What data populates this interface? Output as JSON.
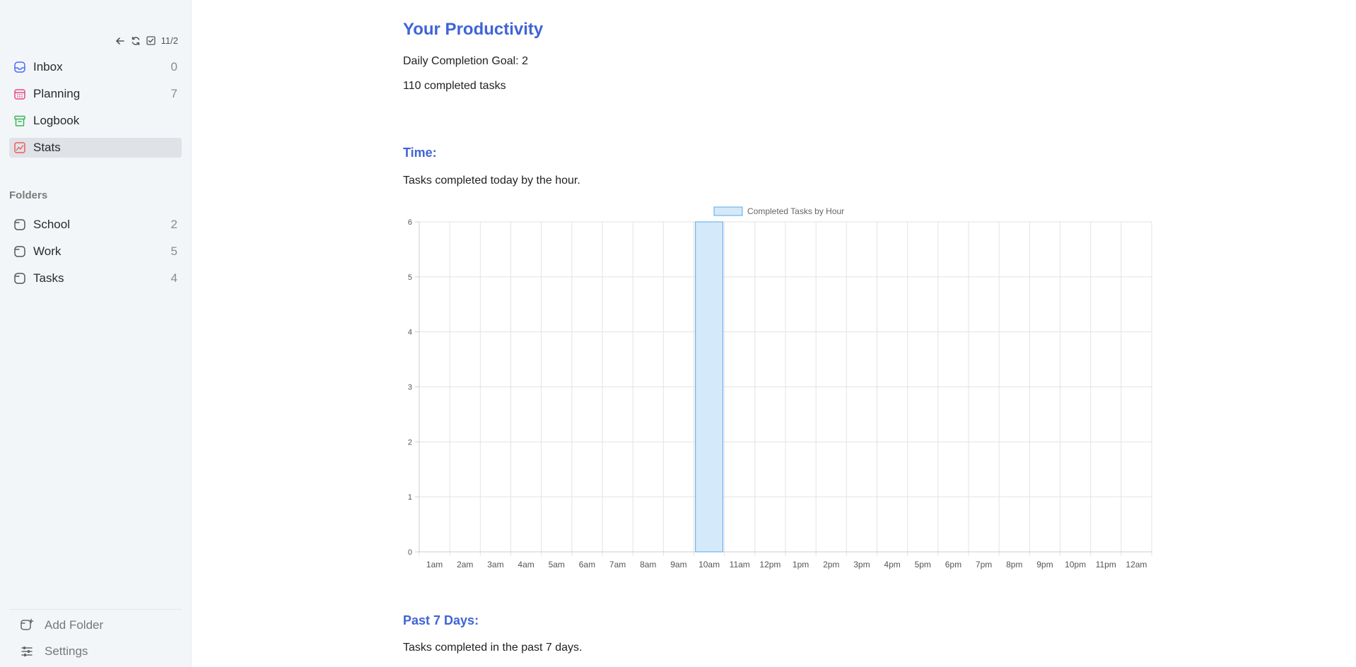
{
  "sidebar": {
    "toolbar": {
      "date": "11/2"
    },
    "nav": [
      {
        "label": "Inbox",
        "count": "0",
        "icon": "inbox-icon",
        "color": "#4a6cf7"
      },
      {
        "label": "Planning",
        "count": "7",
        "icon": "calendar-icon",
        "color": "#e8477a"
      },
      {
        "label": "Logbook",
        "count": "",
        "icon": "archive-icon",
        "color": "#3cb35a"
      },
      {
        "label": "Stats",
        "count": "",
        "icon": "chart-icon",
        "color": "#ef5b5b"
      }
    ],
    "folders_title": "Folders",
    "folders": [
      {
        "label": "School",
        "count": "2",
        "icon": "folder-icon"
      },
      {
        "label": "Work",
        "count": "5",
        "icon": "folder-icon"
      },
      {
        "label": "Tasks",
        "count": "4",
        "icon": "folder-icon"
      }
    ],
    "add_folder": "Add Folder",
    "settings": "Settings"
  },
  "main": {
    "title": "Your Productivity",
    "goal": "Daily Completion Goal: 2",
    "completed": "110 completed tasks",
    "time_heading": "Time:",
    "time_desc": "Tasks completed today by the hour.",
    "past_heading": "Past 7 Days:",
    "past_desc": "Tasks completed in the past 7 days."
  },
  "colors": {
    "accent": "#3f64d6",
    "bar_fill": "#d4e9fa",
    "bar_stroke": "#5aa9e6"
  },
  "chart_data": {
    "type": "bar",
    "legend": "Completed Tasks by Hour",
    "legend_position": "top",
    "categories": [
      "1am",
      "2am",
      "3am",
      "4am",
      "5am",
      "6am",
      "7am",
      "8am",
      "9am",
      "10am",
      "11am",
      "12pm",
      "1pm",
      "2pm",
      "3pm",
      "4pm",
      "5pm",
      "6pm",
      "7pm",
      "8pm",
      "9pm",
      "10pm",
      "11pm",
      "12am"
    ],
    "values": [
      0,
      0,
      0,
      0,
      0,
      0,
      0,
      0,
      0,
      6,
      0,
      0,
      0,
      0,
      0,
      0,
      0,
      0,
      0,
      0,
      0,
      0,
      0,
      0
    ],
    "ylim": [
      0,
      6
    ],
    "yticks": [
      0,
      1,
      2,
      3,
      4,
      5,
      6
    ],
    "grid": true
  }
}
